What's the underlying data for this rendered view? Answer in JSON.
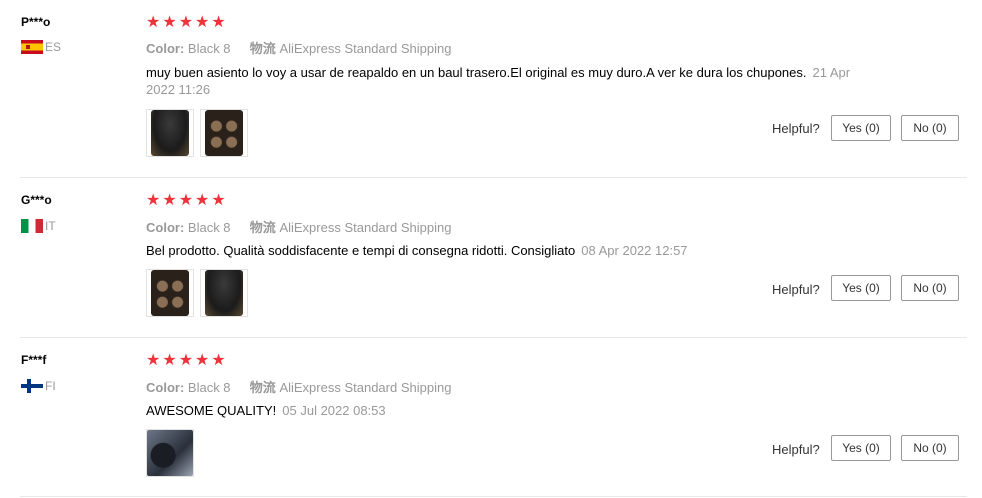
{
  "labels": {
    "color_key": "Color:",
    "shipping_key": "物流",
    "helpful": "Helpful?"
  },
  "reviews": [
    {
      "user": "P***o",
      "country_code": "ES",
      "flag": "spain-flag-icon",
      "rating": 5,
      "color": "Black 8",
      "shipping": "AliExpress Standard Shipping",
      "text": "muy buen asiento lo voy a usar de reapaldo en un baul trasero.El original es muy duro.A ver ke dura los chupones.",
      "date": "21 Apr 2022 11:26",
      "photos": [
        "seat-photo",
        "suction-cups-photo"
      ],
      "yes": "Yes (0)",
      "no": "No (0)"
    },
    {
      "user": "G***o",
      "country_code": "IT",
      "flag": "italy-flag-icon",
      "rating": 5,
      "color": "Black 8",
      "shipping": "AliExpress Standard Shipping",
      "text": "Bel prodotto. Qualità soddisfacente e tempi di consegna ridotti. Consigliato",
      "date": "08 Apr 2022 12:57",
      "photos": [
        "suction-cups-photo",
        "seat-photo"
      ],
      "yes": "Yes (0)",
      "no": "No (0)"
    },
    {
      "user": "F***f",
      "country_code": "FI",
      "flag": "finland-flag-icon",
      "rating": 5,
      "color": "Black 8",
      "shipping": "AliExpress Standard Shipping",
      "text": "AWESOME QUALITY!",
      "date": "05 Jul 2022 08:53",
      "photos": [
        "motorcycle-photo"
      ],
      "yes": "Yes (0)",
      "no": "No (0)"
    }
  ],
  "colors": {
    "star": "#f0323c",
    "muted": "#999999",
    "divider": "#e8e8e8"
  }
}
